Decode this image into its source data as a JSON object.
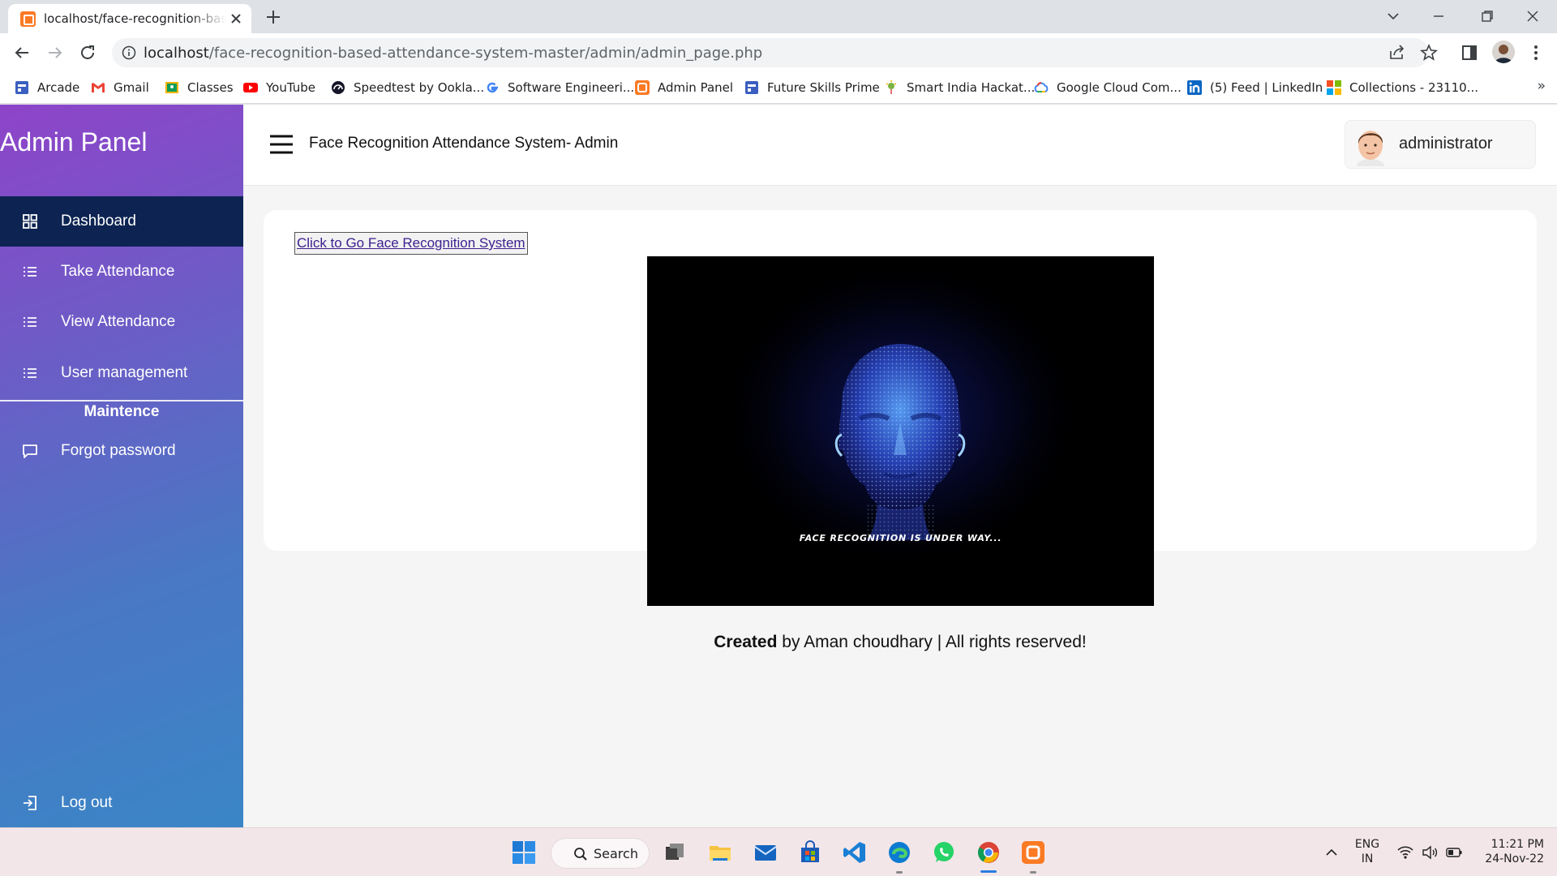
{
  "browser": {
    "tab_title": "localhost/face-recognition-based-attendance-system-master/admin/admin_page.php",
    "url_host": "localhost",
    "url_path": "/face-recognition-based-attendance-system-master/admin/admin_page.php",
    "bookmarks": [
      {
        "label": "Arcade",
        "icon": "arcade-icon",
        "color": "#3b5fc0"
      },
      {
        "label": "Gmail",
        "icon": "gmail-icon",
        "color": "#ea4335"
      },
      {
        "label": "Classes",
        "icon": "classroom-icon",
        "color": "#f4b400"
      },
      {
        "label": "YouTube",
        "icon": "youtube-icon",
        "color": "#ff0000"
      },
      {
        "label": "Speedtest by Ookla...",
        "icon": "speedtest-icon",
        "color": "#141526"
      },
      {
        "label": "Software Engineeri...",
        "icon": "google-icon",
        "color": "#4285f4"
      },
      {
        "label": "Admin Panel",
        "icon": "xampp-icon",
        "color": "#fb7a24"
      },
      {
        "label": "Future Skills Prime",
        "icon": "futureskills-icon",
        "color": "#3b5fc0"
      },
      {
        "label": "Smart India Hackat...",
        "icon": "sih-icon",
        "color": "#7cb342"
      },
      {
        "label": "Google Cloud Com...",
        "icon": "google-cloud-icon",
        "color": "#4285f4"
      },
      {
        "label": "(5) Feed | LinkedIn",
        "icon": "linkedin-icon",
        "color": "#0a66c2"
      },
      {
        "label": "Collections - 23110...",
        "icon": "microsoft-icon",
        "color": "#f25022"
      }
    ],
    "more": "»"
  },
  "sidebar": {
    "brand": "Admin Panel",
    "items": [
      {
        "label": "Dashboard",
        "icon": "dashboard-grid-icon"
      },
      {
        "label": "Take Attendance",
        "icon": "list-icon"
      },
      {
        "label": "View Attendance",
        "icon": "list-icon"
      },
      {
        "label": "User management",
        "icon": "list-icon"
      }
    ],
    "section_title": "Maintence",
    "section_items": [
      {
        "label": "Forgot password",
        "icon": "message-icon"
      }
    ],
    "logout": "Log out",
    "colors": {
      "gradient_top": "#8e44c9",
      "gradient_bottom": "#3a86c6",
      "active": "#0d2452"
    }
  },
  "header": {
    "title": "Face Recognition Attendance System- Admin",
    "user": "administrator"
  },
  "main": {
    "go_button": "Click to Go Face Recognition System",
    "image_caption": "FACE RECOGNITION IS UNDER WAY..."
  },
  "footer": {
    "strong": "Created",
    "rest": " by Aman choudhary | All rights reserved!"
  },
  "taskbar": {
    "search_label": "Search",
    "lang_top": "ENG",
    "lang_bottom": "IN",
    "time": "11:21 PM",
    "date": "24-Nov-22"
  }
}
